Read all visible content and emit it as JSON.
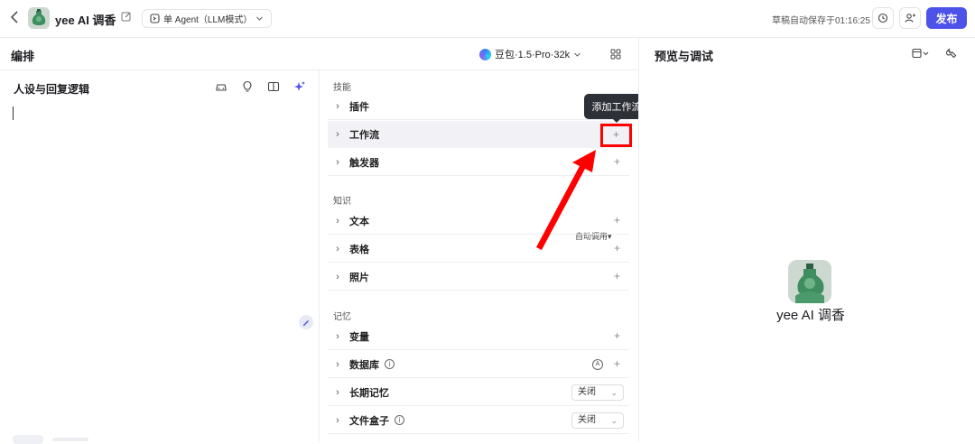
{
  "header": {
    "bot_name": "yee AI 调香",
    "agent_mode": "单 Agent（LLM模式）",
    "autosave": "草稿自动保存于01:16:25",
    "publish_label": "发布"
  },
  "editor": {
    "title": "编排",
    "model": "豆包·1.5·Pro·32k"
  },
  "persona": {
    "title": "人设与回复逻辑"
  },
  "skills": {
    "group_title": "技能",
    "items": [
      {
        "label": "插件"
      },
      {
        "label": "工作流"
      },
      {
        "label": "触发器"
      }
    ]
  },
  "knowledge": {
    "group_title": "知识",
    "auto_call": "自动调用",
    "items": [
      {
        "label": "文本"
      },
      {
        "label": "表格"
      },
      {
        "label": "照片"
      }
    ]
  },
  "memory": {
    "group_title": "记忆",
    "items": [
      {
        "label": "变量"
      },
      {
        "label": "数据库",
        "badge": "A"
      },
      {
        "label": "长期记忆",
        "select": "关闭"
      },
      {
        "label": "文件盒子",
        "select": "关闭"
      }
    ]
  },
  "tooltip": {
    "text": "添加工作流"
  },
  "preview": {
    "title": "预览与调试",
    "bot_name": "yee AI 调香"
  },
  "colors": {
    "accent": "#4d53e8",
    "annotation_red": "#ff0000",
    "tooltip_bg": "#2e3038"
  },
  "icons": [
    "back-icon",
    "edit-icon",
    "agent-icon",
    "history-icon",
    "users-icon",
    "grid-icon",
    "car-icon",
    "bulb-icon",
    "split-icon",
    "sparkle-icon",
    "chevron-right-icon",
    "plus-icon",
    "info-icon",
    "wrench-icon",
    "calendar-icon"
  ]
}
